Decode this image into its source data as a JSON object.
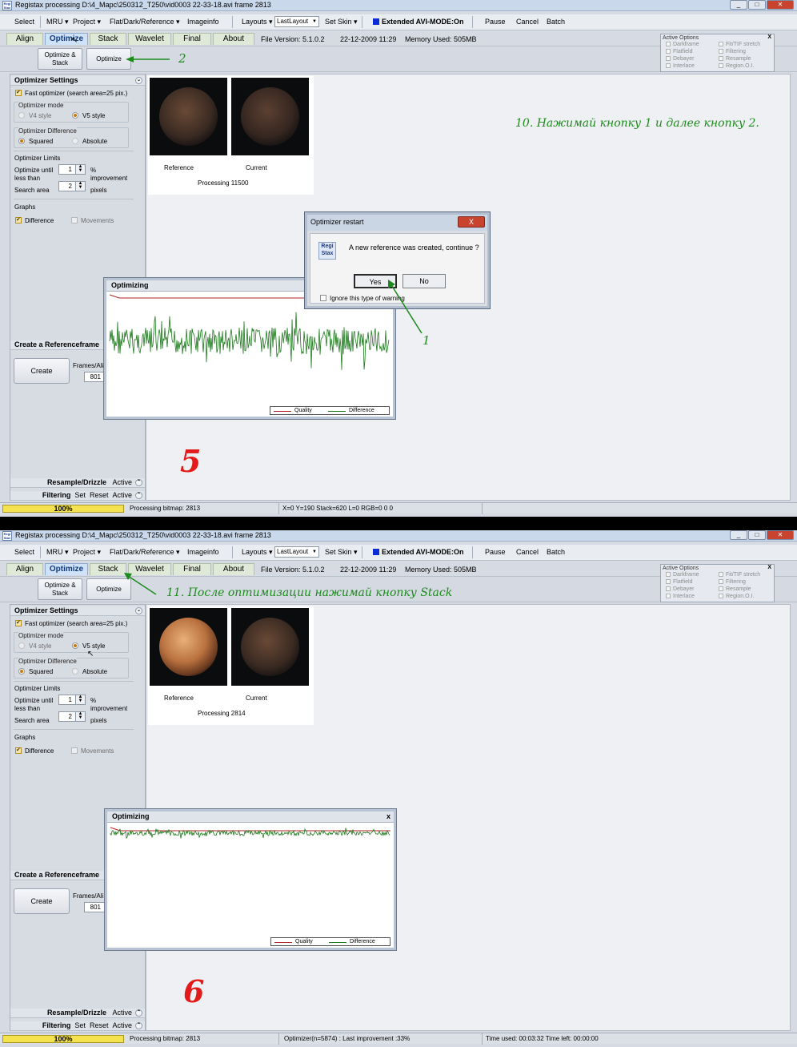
{
  "top": {
    "window_title": "Registax processing D:\\4_Марс\\250312_T250\\vid0003 22-33-18.avi frame 2813",
    "app_icon": "Regi Stax",
    "menu": {
      "select": "Select",
      "mru": "MRU ▾",
      "project": "Project ▾",
      "flat": "Flat/Dark/Reference ▾",
      "imageinfo": "Imageinfo",
      "layouts": "Layouts ▾",
      "layout_value": "LastLayout",
      "skin": "Set Skin ▾",
      "avi": "Extended AVI-MODE:On",
      "pause": "Pause",
      "cancel": "Cancel",
      "batch": "Batch"
    },
    "tabs": [
      "Align",
      "Optimize",
      "Stack",
      "Wavelet",
      "Final",
      "About"
    ],
    "file_version": "File Version: 5.1.0.2",
    "date": "22-12-2009 11:29",
    "memory": "Memory Used: 505MB",
    "sub_buttons": {
      "opt_stack": "Optimize & Stack",
      "optimize": "Optimize"
    },
    "active_options": {
      "title": "Active Options",
      "close": "X",
      "left": [
        "Darkframe",
        "Flatfield",
        "Debayer",
        "Interlace"
      ],
      "right": [
        "Fit/TIF stretch",
        "Filtering",
        "Resample",
        "Region.O.I."
      ]
    },
    "settings": {
      "header": "Optimizer Settings",
      "fast": "Fast optimizer (search area=25 pix.)",
      "mode_title": "Optimizer mode",
      "v4": "V4 style",
      "v5": "V5 style",
      "diff_title": "Optimizer Difference",
      "squared": "Squared",
      "absolute": "Absolute",
      "limits": "Optimizer Limits",
      "until1": "Optimize until",
      "until2": "less than",
      "until_val": "1",
      "pct": "%",
      "improvement": "improvement",
      "search": "Search area",
      "search_val": "2",
      "pixels": "pixels",
      "graphs": "Graphs",
      "difference": "Difference",
      "movements": "Movements"
    },
    "refframe": {
      "header": "Create a Referenceframe",
      "create": "Create",
      "frames": "Frames/Ali",
      "frames_val": "801"
    },
    "resample": {
      "label": "Resample/Drizzle",
      "active": "Active"
    },
    "filtering": {
      "label": "Filtering",
      "set": "Set",
      "reset": "Reset",
      "active": "Active"
    },
    "thumbs": {
      "reference": "Reference",
      "current": "Current",
      "processing": "Processing 11500"
    },
    "graph": {
      "title": "Optimizing",
      "close": "x",
      "quality": "Quality",
      "difference": "Difference"
    },
    "dialog": {
      "title": "Optimizer restart",
      "close": "X",
      "message": "A new reference was created, continue ?",
      "yes": "Yes",
      "no": "No",
      "ignore": "Ignore this type of warning"
    },
    "status": {
      "progress": "100%",
      "progress_value": 1.0,
      "processing": "Processing bitmap: 2813",
      "coords": "X=0 Y=190 Stack=620 L=0 RGB=0 0 0"
    },
    "annotations": {
      "step10": "10. Нажимай кнопку 1 и далее кнопку 2.",
      "num2": "2",
      "num1": "1",
      "big": "5"
    },
    "colors": {
      "annotation": "#1e8a1e",
      "big_number": "#e31a1a",
      "quality_line": "#b22222",
      "difference_line": "#1a7a1a"
    }
  },
  "bottom": {
    "window_title": "Registax processing D:\\4_Марс\\250312_T250\\vid0003 22-33-18.avi frame 2813",
    "app_icon": "Regi Stax",
    "menu": {
      "select": "Select",
      "mru": "MRU ▾",
      "project": "Project ▾",
      "flat": "Flat/Dark/Reference ▾",
      "imageinfo": "Imageinfo",
      "layouts": "Layouts ▾",
      "layout_value": "LastLayout",
      "skin": "Set Skin ▾",
      "avi": "Extended AVI-MODE:On",
      "pause": "Pause",
      "cancel": "Cancel",
      "batch": "Batch"
    },
    "tabs": [
      "Align",
      "Optimize",
      "Stack",
      "Wavelet",
      "Final",
      "About"
    ],
    "file_version": "File Version: 5.1.0.2",
    "date": "22-12-2009 11:29",
    "memory": "Memory Used: 505MB",
    "sub_buttons": {
      "opt_stack": "Optimize & Stack",
      "optimize": "Optimize"
    },
    "active_options": {
      "title": "Active Options",
      "close": "X",
      "left": [
        "Darkframe",
        "Flatfield",
        "Debayer",
        "Interlace"
      ],
      "right": [
        "Fit/TIF stretch",
        "Filtering",
        "Resample",
        "Region.O.I."
      ]
    },
    "settings": {
      "header": "Optimizer Settings",
      "fast": "Fast optimizer (search area=25 pix.)",
      "mode_title": "Optimizer mode",
      "v4": "V4 style",
      "v5": "V5 style",
      "diff_title": "Optimizer Difference",
      "squared": "Squared",
      "absolute": "Absolute",
      "limits": "Optimizer Limits",
      "until1": "Optimize until",
      "until2": "less than",
      "until_val": "1",
      "pct": "%",
      "improvement": "improvement",
      "search": "Search area",
      "search_val": "2",
      "pixels": "pixels",
      "graphs": "Graphs",
      "difference": "Difference",
      "movements": "Movements"
    },
    "refframe": {
      "header": "Create a Referenceframe",
      "create": "Create",
      "frames": "Frames/Ali",
      "frames_val": "801"
    },
    "resample": {
      "label": "Resample/Drizzle",
      "active": "Active"
    },
    "filtering": {
      "label": "Filtering",
      "set": "Set",
      "reset": "Reset",
      "active": "Active"
    },
    "thumbs": {
      "reference": "Reference",
      "current": "Current",
      "processing": "Processing 2814"
    },
    "graph": {
      "title": "Optimizing",
      "close": "x",
      "quality": "Quality",
      "difference": "Difference"
    },
    "status": {
      "progress": "100%",
      "progress_value": 1.0,
      "processing": "Processing bitmap: 2813",
      "optimizer": "Optimizer(n=5874) : Last improvement :33%",
      "time": "Time used: 00:03:32 Time left: 00:00:00"
    },
    "annotations": {
      "step11": "11. После оптимизации нажимай кнопку Stack",
      "big": "6"
    }
  }
}
